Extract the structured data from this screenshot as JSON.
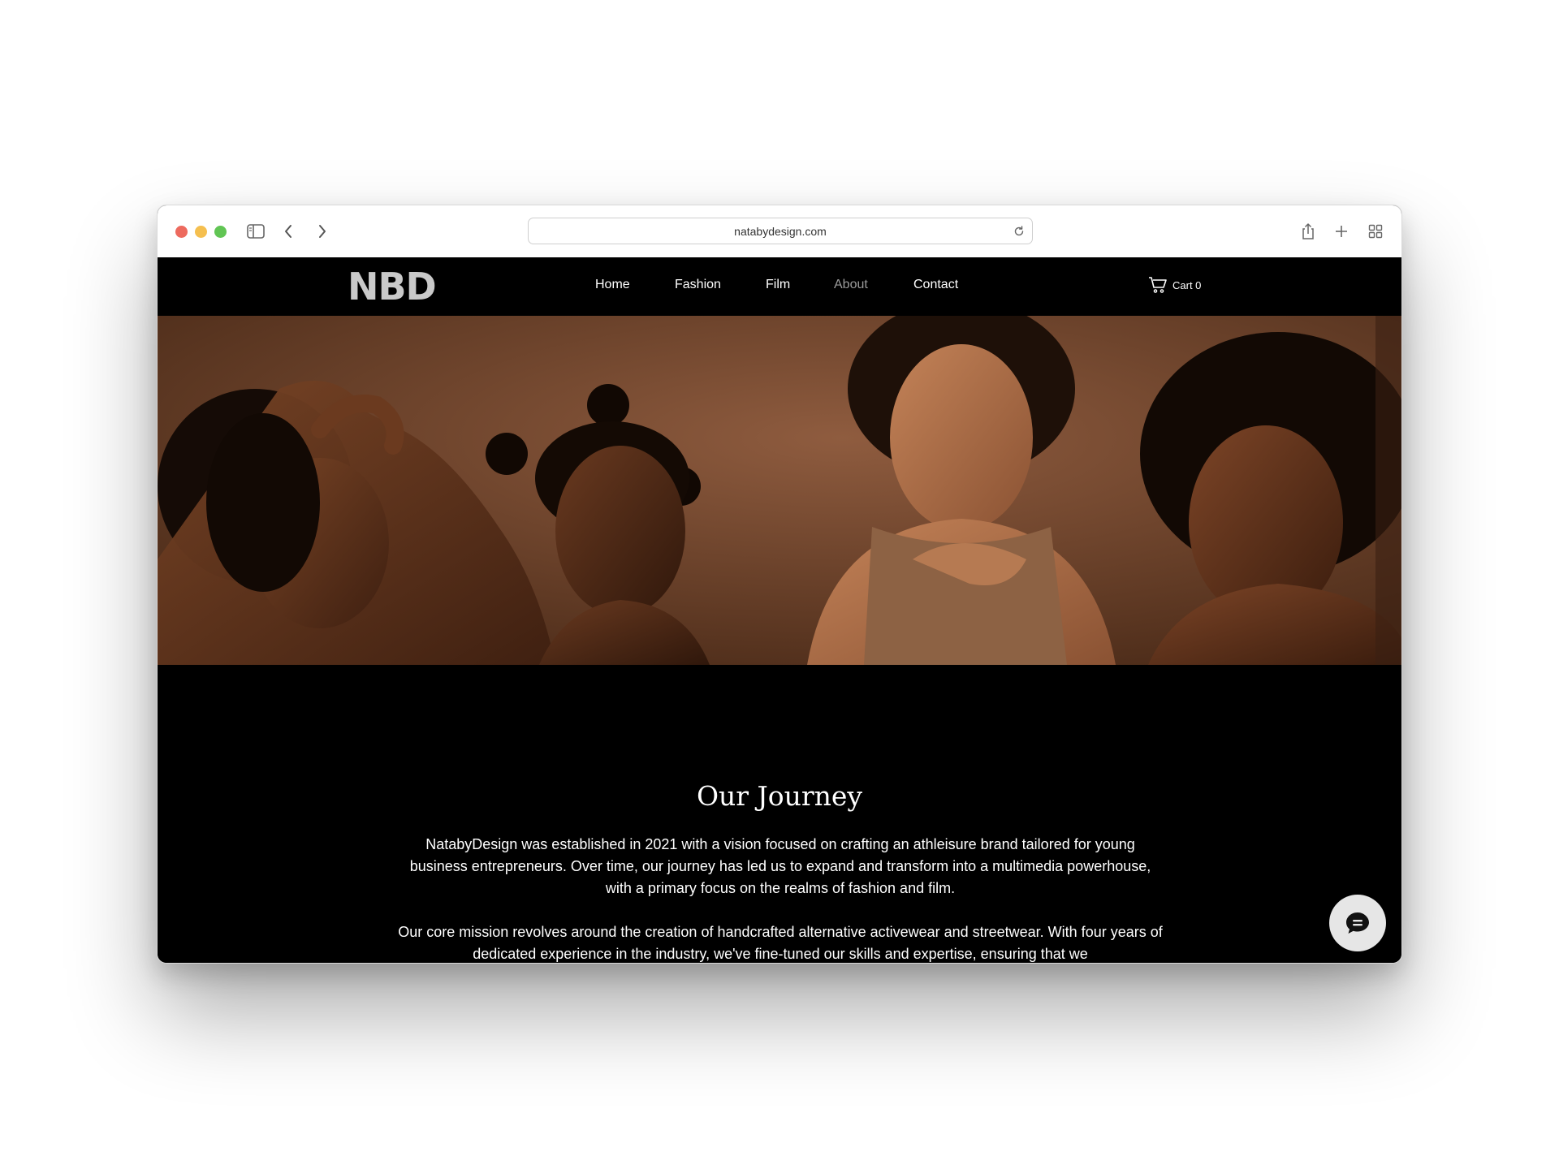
{
  "browser": {
    "url": "natabydesign.com"
  },
  "site": {
    "logo": "NBD",
    "nav": [
      {
        "label": "Home"
      },
      {
        "label": "Fashion"
      },
      {
        "label": "Film"
      },
      {
        "label": "About"
      },
      {
        "label": "Contact"
      }
    ],
    "active_nav": "About",
    "cart_label": "Cart 0"
  },
  "content": {
    "heading": "Our Journey",
    "paragraph_1": "NatabyDesign was established in 2021 with a vision focused on crafting an athleisure brand tailored for young business entrepreneurs. Over time, our journey has led us to expand and transform into a multimedia powerhouse, with a primary focus on the realms of fashion and film.",
    "paragraph_2": "Our core mission revolves around the creation of handcrafted alternative activewear and streetwear. With four years of dedicated experience in the industry, we've fine-tuned our skills and expertise, ensuring that we"
  },
  "icons": {
    "sidebar": "sidebar-icon",
    "back": "chevron-left-icon",
    "forward": "chevron-right-icon",
    "reload": "reload-icon",
    "share": "share-icon",
    "new_tab": "plus-icon",
    "tabs": "tab-overview-icon",
    "cart": "cart-icon",
    "chat": "chat-icon"
  },
  "colors": {
    "page_bg": "#000000",
    "nav_text": "#ffffff",
    "nav_active": "#9b9b9b",
    "logo": "#c9c9c9",
    "chat_button": "#e6e6e6"
  }
}
